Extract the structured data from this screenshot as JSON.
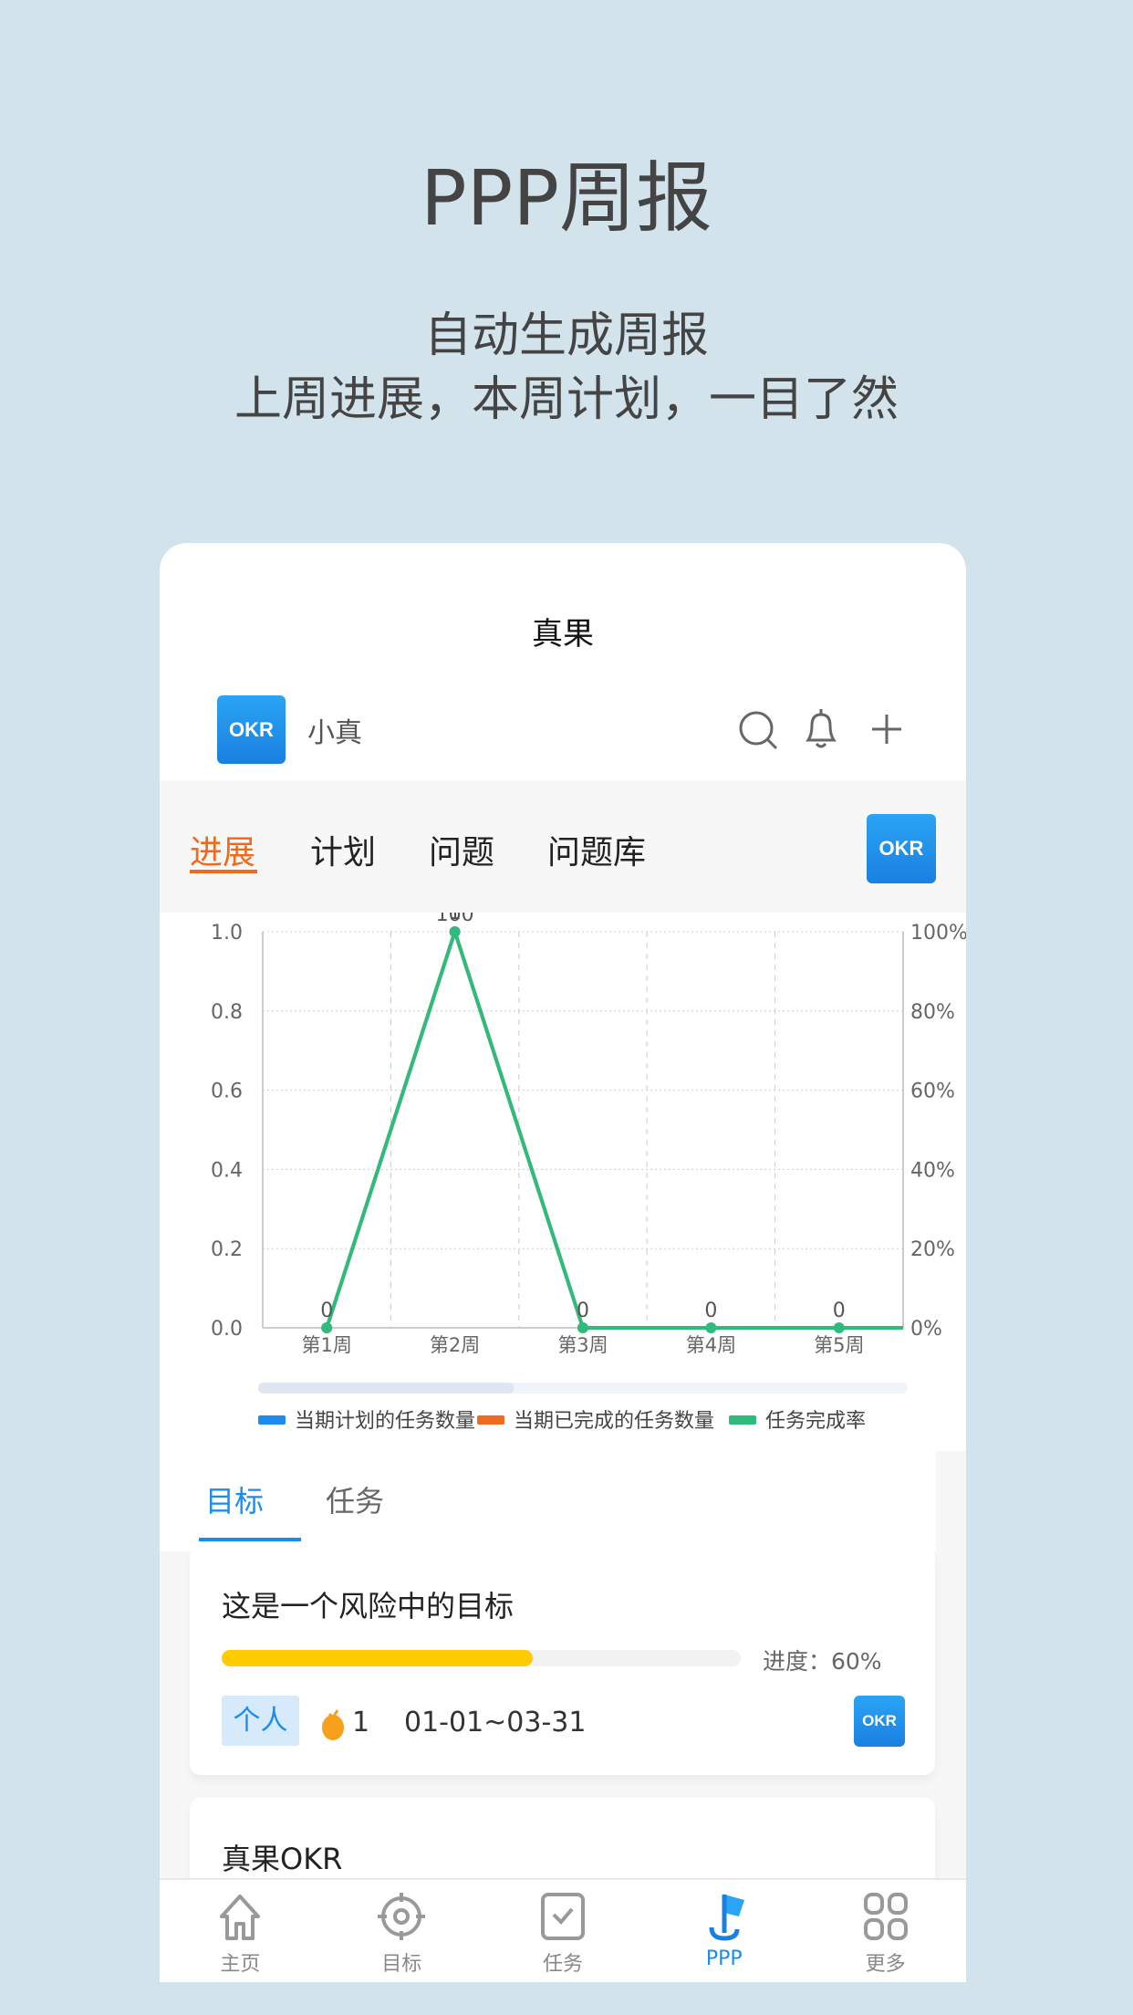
{
  "promo": {
    "title": "PPP周报",
    "line1": "自动生成周报",
    "line2": "上周进展，本周计划，一目了然"
  },
  "app": {
    "title": "真果",
    "user": "小真",
    "logo_text": "OKR",
    "icons": [
      "search-icon",
      "bell-icon",
      "plus-icon"
    ]
  },
  "tabs": [
    {
      "label": "进展",
      "active": true
    },
    {
      "label": "计划"
    },
    {
      "label": "问题"
    },
    {
      "label": "问题库"
    }
  ],
  "subtabs": [
    {
      "label": "目标",
      "active": true
    },
    {
      "label": "任务"
    }
  ],
  "chart_data": {
    "type": "line",
    "categories": [
      "第1周",
      "第2周",
      "第3周",
      "第4周",
      "第5周"
    ],
    "left_axis": {
      "ticks": [
        "0.0",
        "0.2",
        "0.4",
        "0.6",
        "0.8",
        "1.0"
      ],
      "range": [
        0,
        1
      ]
    },
    "right_axis": {
      "ticks": [
        "0%",
        "20%",
        "40%",
        "60%",
        "80%",
        "100%"
      ],
      "range": [
        0,
        100
      ]
    },
    "grid": true,
    "legend_position": "bottom",
    "series": [
      {
        "name": "当期计划的任务数量",
        "color": "#1a8cf0",
        "values": [
          null,
          null,
          null,
          null,
          null
        ],
        "axis": "left"
      },
      {
        "name": "当期已完成的任务数量",
        "color": "#ee6a1c",
        "values": [
          0,
          1,
          0,
          null,
          null
        ],
        "axis": "left"
      },
      {
        "name": "任务完成率",
        "color": "#2dbb7e",
        "values": [
          0,
          100,
          0,
          0,
          0
        ],
        "axis": "right"
      }
    ],
    "data_labels": [
      "0",
      "100",
      "0",
      "0",
      "0"
    ],
    "orange_label": "1"
  },
  "goals": [
    {
      "title": "这是一个风险中的目标",
      "progress_label": "进度：60%",
      "progress": 60,
      "tag": "个人",
      "count": "1",
      "date": "01-01~03-31",
      "logo_text": "OKR"
    },
    {
      "title": "真果OKR"
    }
  ],
  "nav": [
    {
      "label": "主页",
      "icon": "home-icon"
    },
    {
      "label": "目标",
      "icon": "target-icon"
    },
    {
      "label": "任务",
      "icon": "task-icon"
    },
    {
      "label": "PPP",
      "icon": "flag-icon",
      "active": true
    },
    {
      "label": "更多",
      "icon": "grid-icon"
    }
  ],
  "colors": {
    "accent": "#1a8cf0",
    "tab_active": "#ee6a1c",
    "progress": "#ffcc00",
    "bg": "#d2e3ec"
  }
}
